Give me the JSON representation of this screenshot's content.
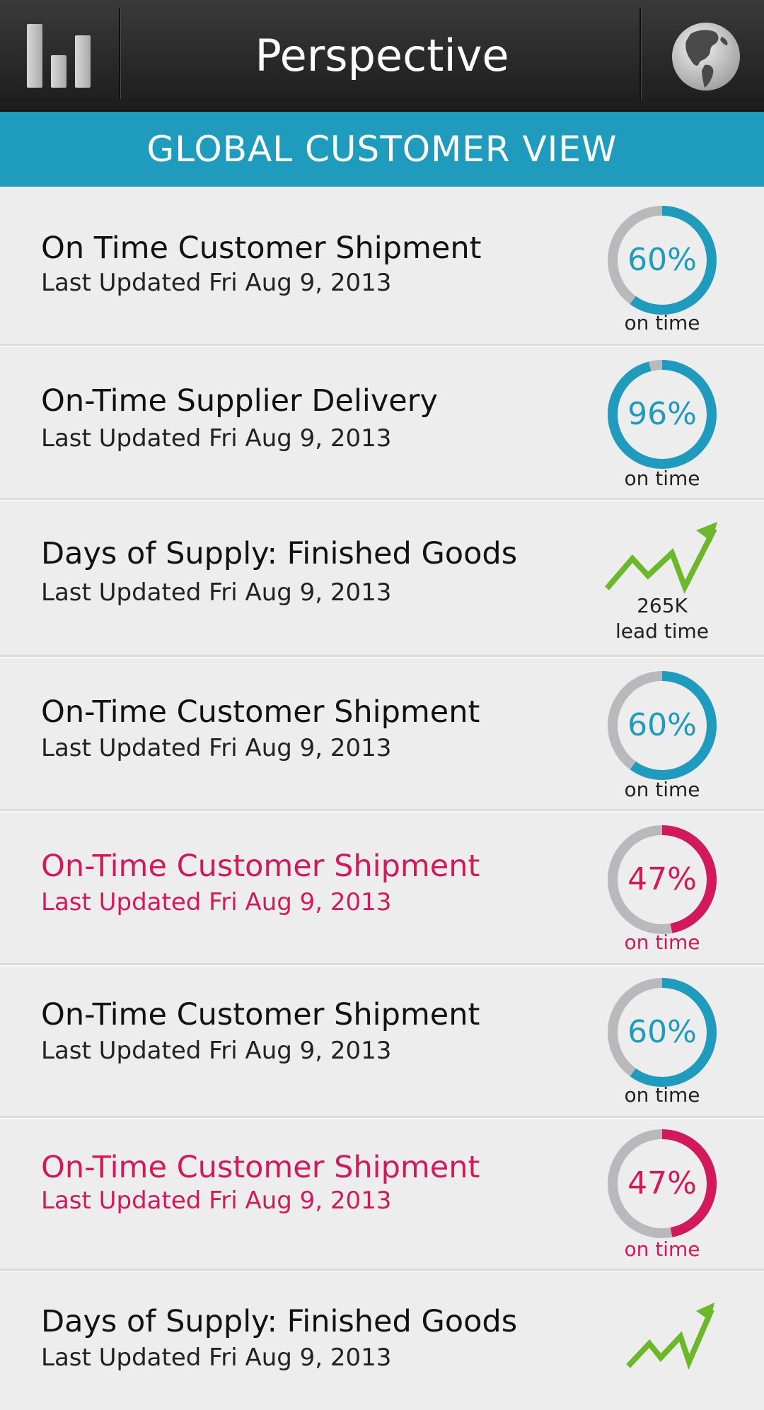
{
  "header": {
    "title": "Perspective",
    "left_icon": "bar-chart-icon",
    "right_icon": "globe-icon"
  },
  "banner": {
    "title": "GLOBAL CUSTOMER VIEW"
  },
  "colors": {
    "accent": "#1e9bbd",
    "alert": "#d21a5b",
    "trend": "#6cb82a",
    "track": "#b9b9bb"
  },
  "metrics": [
    {
      "title": "On Time Customer Shipment",
      "updated": "Last Updated Fri Aug 9, 2013",
      "kind": "ring",
      "value": 60,
      "value_label": "60%",
      "caption": "on time",
      "status": "normal"
    },
    {
      "title": "On-Time Supplier Delivery",
      "updated": "Last Updated Fri Aug 9, 2013",
      "kind": "ring",
      "value": 96,
      "value_label": "96%",
      "caption": "on time",
      "status": "normal"
    },
    {
      "title": "Days of Supply: Finished Goods",
      "updated": "Last Updated Fri Aug 9, 2013",
      "kind": "trend",
      "trend_icon": "trend-up-icon",
      "value_label": "265K",
      "caption": "lead time",
      "status": "normal"
    },
    {
      "title": "On-Time Customer Shipment",
      "updated": "Last Updated Fri Aug 9, 2013",
      "kind": "ring",
      "value": 60,
      "value_label": "60%",
      "caption": "on time",
      "status": "normal"
    },
    {
      "title": "On-Time Customer Shipment",
      "updated": "Last Updated Fri Aug 9, 2013",
      "kind": "ring",
      "value": 47,
      "value_label": "47%",
      "caption": "on time",
      "status": "alert"
    },
    {
      "title": "On-Time Customer Shipment",
      "updated": "Last Updated Fri Aug 9, 2013",
      "kind": "ring",
      "value": 60,
      "value_label": "60%",
      "caption": "on time",
      "status": "normal"
    },
    {
      "title": "On-Time Customer Shipment",
      "updated": "Last Updated Fri Aug 9, 2013",
      "kind": "ring",
      "value": 47,
      "value_label": "47%",
      "caption": "on time",
      "status": "alert"
    },
    {
      "title": "Days of Supply: Finished Goods",
      "updated": "Last Updated Fri Aug 9, 2013",
      "kind": "trend",
      "trend_icon": "trend-up-icon",
      "value_label": "",
      "caption": "",
      "status": "normal"
    }
  ]
}
